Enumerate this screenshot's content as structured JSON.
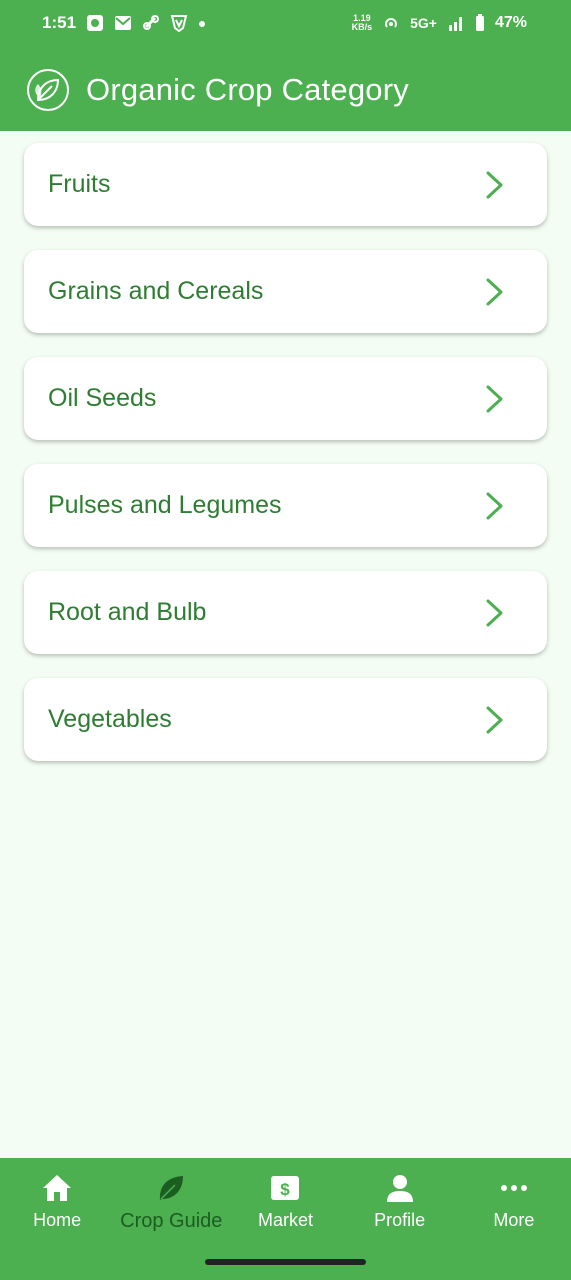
{
  "status": {
    "time": "1:51",
    "speed_value": "1.19",
    "speed_unit": "KB/s",
    "network": "5G+",
    "battery": "47%"
  },
  "appbar": {
    "title": "Organic Crop Category",
    "logo_icon": "leaf-circle-icon"
  },
  "categories": [
    {
      "label": "Fruits"
    },
    {
      "label": "Grains and Cereals"
    },
    {
      "label": "Oil Seeds"
    },
    {
      "label": "Pulses and Legumes"
    },
    {
      "label": "Root and Bulb"
    },
    {
      "label": "Vegetables"
    }
  ],
  "nav": {
    "items": [
      {
        "label": "Home",
        "icon": "home-icon"
      },
      {
        "label": "Crop Guide",
        "icon": "leaf-icon",
        "active": true
      },
      {
        "label": "Market",
        "icon": "dollar-sign-icon"
      },
      {
        "label": "Profile",
        "icon": "person-icon"
      },
      {
        "label": "More",
        "icon": "more-dots-icon"
      }
    ]
  },
  "colors": {
    "primary": "#4caf50",
    "text_green": "#2e7d32",
    "active_nav": "#1b5e20",
    "background": "#f3fdf3"
  }
}
